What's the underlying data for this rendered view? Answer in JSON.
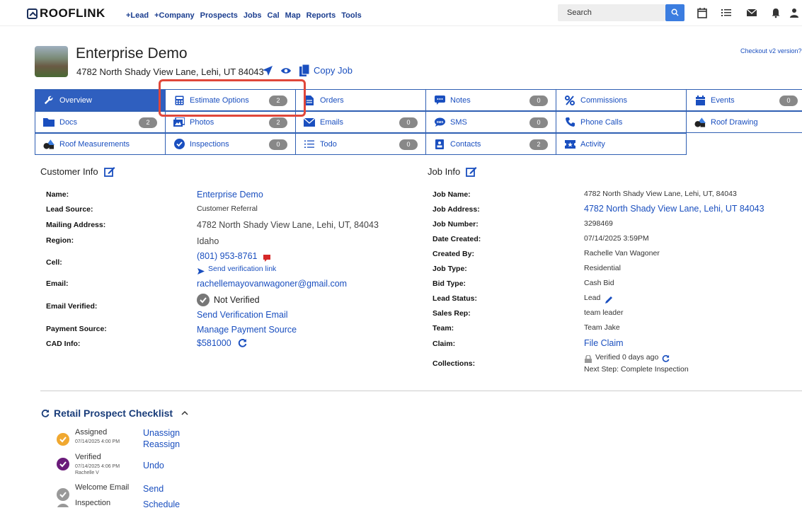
{
  "nav": {
    "brand": "ROOFLINK",
    "links": [
      "+Lead",
      "+Company",
      "Prospects",
      "Jobs",
      "Cal",
      "Map",
      "Reports",
      "Tools"
    ],
    "search_placeholder": "Search"
  },
  "header": {
    "title": "Enterprise Demo",
    "address": "4782 North Shady View Lane, Lehi, UT 84043",
    "copy_job": "Copy Job",
    "checkout": "Checkout v2 version?"
  },
  "tabs": [
    {
      "label": "Overview",
      "icon": "wrench-icon",
      "badge": "",
      "active": true
    },
    {
      "label": "Estimate Options",
      "icon": "calculator-icon",
      "badge": "2",
      "active": false
    },
    {
      "label": "Orders",
      "icon": "document-icon",
      "badge": "",
      "active": false
    },
    {
      "label": "Notes",
      "icon": "note-icon",
      "badge": "0",
      "active": false
    },
    {
      "label": "Commissions",
      "icon": "percent-icon",
      "badge": "",
      "active": false
    },
    {
      "label": "Events",
      "icon": "calendar-icon",
      "badge": "0",
      "active": false
    },
    {
      "label": "Docs",
      "icon": "folder-icon",
      "badge": "2",
      "active": false
    },
    {
      "label": "Photos",
      "icon": "photos-icon",
      "badge": "2",
      "active": false
    },
    {
      "label": "Emails",
      "icon": "envelope-icon",
      "badge": "0",
      "active": false
    },
    {
      "label": "SMS",
      "icon": "sms-icon",
      "badge": "0",
      "active": false
    },
    {
      "label": "Phone Calls",
      "icon": "phone-icon",
      "badge": "",
      "active": false
    },
    {
      "label": "Roof Drawing",
      "icon": "shapes-icon",
      "badge": "",
      "active": false
    },
    {
      "label": "Roof Measurements",
      "icon": "shapes-icon",
      "badge": "",
      "active": false
    },
    {
      "label": "Inspections",
      "icon": "check-circle-icon",
      "badge": "0",
      "active": false
    },
    {
      "label": "Todo",
      "icon": "list-icon",
      "badge": "0",
      "active": false
    },
    {
      "label": "Contacts",
      "icon": "contact-icon",
      "badge": "2",
      "active": false
    },
    {
      "label": "Activity",
      "icon": "ticket-icon",
      "badge": "",
      "active": false
    }
  ],
  "customer": {
    "title": "Customer Info",
    "rows": [
      {
        "label": "Name:",
        "value": "Enterprise Demo"
      },
      {
        "label": "Lead Source:",
        "value": "Customer Referral"
      },
      {
        "label": "Mailing Address:",
        "value": "4782 North Shady View Lane, Lehi, UT, 84043"
      },
      {
        "label": "Region:",
        "value": "Idaho"
      },
      {
        "label": "Cell:",
        "value": "(801) 953-8761",
        "sub": "Send verification link"
      },
      {
        "label": "Email:",
        "value": "rachellemayovanwagoner@gmail.com"
      },
      {
        "label": "Email Verified:",
        "value": "Not Verified",
        "sub": "Send Verification Email"
      },
      {
        "label": "Payment Source:",
        "value": "Manage Payment Source"
      },
      {
        "label": "CAD Info:",
        "value": "$581000"
      }
    ]
  },
  "job": {
    "title": "Job Info",
    "rows": [
      {
        "label": "Job Name:",
        "value": "4782 North Shady View Lane, Lehi, UT, 84043"
      },
      {
        "label": "Job Address:",
        "value": "4782 North Shady View Lane, Lehi, UT 84043"
      },
      {
        "label": "Job Number:",
        "value": "3298469"
      },
      {
        "label": "Date Created:",
        "value": "07/14/2025 3:59PM"
      },
      {
        "label": "Created By:",
        "value": "Rachelle Van Wagoner"
      },
      {
        "label": "Job Type:",
        "value": "Residential"
      },
      {
        "label": "Bid Type:",
        "value": "Cash Bid"
      },
      {
        "label": "Lead Status:",
        "value": "Lead"
      },
      {
        "label": "Sales Rep:",
        "value": "team leader"
      },
      {
        "label": "Team:",
        "value": "Team Jake"
      },
      {
        "label": "Claim:",
        "value": "File Claim"
      },
      {
        "label": "Collections:",
        "value": "Verified 0 days ago",
        "sub": "Next Step: Complete Inspection"
      }
    ]
  },
  "checklist": {
    "title": "Retail Prospect Checklist",
    "items": [
      {
        "label": "Assigned",
        "date": "07/14/2025 4:00 PM",
        "user": "",
        "actions": [
          "Unassign",
          "Reassign"
        ],
        "color": "#f0a830"
      },
      {
        "label": "Verified",
        "date": "07/14/2025 4:06 PM",
        "user": "Rachelle V",
        "actions": [
          "Undo"
        ],
        "color": "#6a1b7a"
      },
      {
        "label": "Welcome Email",
        "date": "",
        "user": "",
        "actions": [
          "Send"
        ],
        "color": "#999999"
      },
      {
        "label": "Inspection",
        "date": "",
        "user": "",
        "actions": [
          "Schedule"
        ],
        "color": "#999999"
      }
    ]
  }
}
